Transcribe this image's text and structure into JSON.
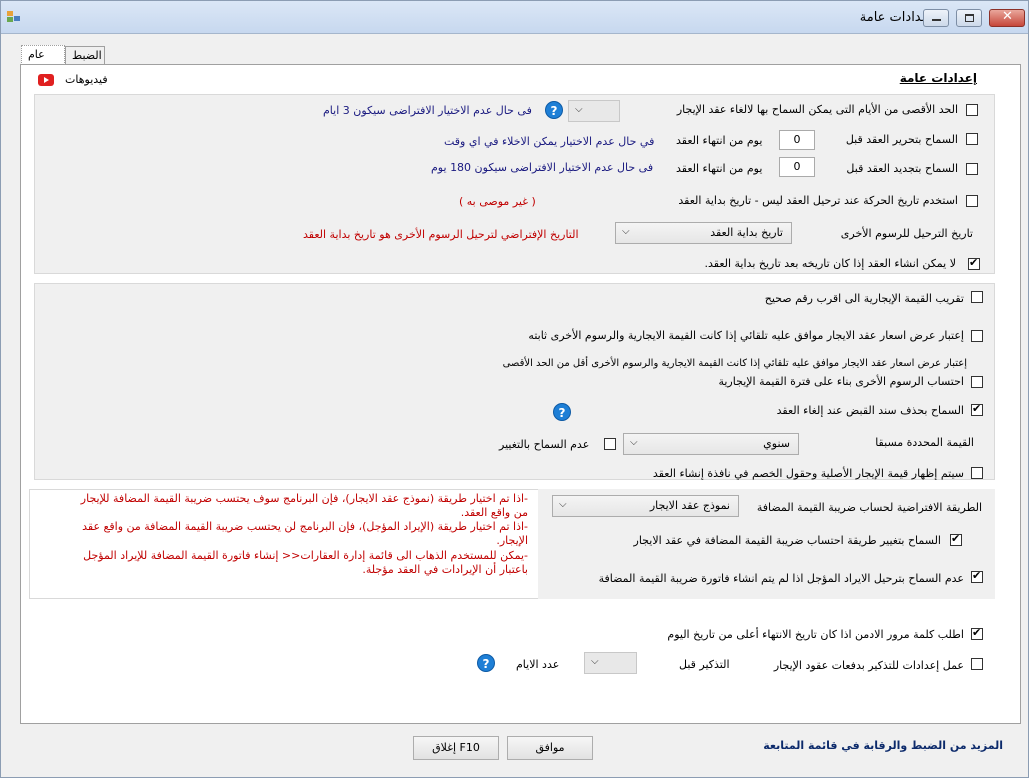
{
  "window": {
    "title": "إعدادات عامة"
  },
  "tabs": [
    {
      "label": "عام"
    },
    {
      "label": "الضبط"
    }
  ],
  "header": {
    "title": "إعدادات عامة",
    "videos_label": "فيديوهات"
  },
  "section1": {
    "max_days_label": "الحد الأقصى من الأيام التى يمكن السماح بها لالغاء عقد الإيجار",
    "max_days_note": "فى حال عدم الاختيار الافتراضى سيكون 3 ايام",
    "edit_before_label": "السماح بتحرير العقد قبل",
    "edit_before_value": "0",
    "edit_before_unit": "يوم من انتهاء العقد",
    "edit_before_note": "في حال عدم الاختيار يمكن الاخلاء في اي وقت",
    "renew_before_label": "السماح بتجديد العقد قبل",
    "renew_before_value": "0",
    "renew_before_unit": "يوم من انتهاء العقد",
    "renew_before_note": "فى حال عدم الاختيار الافتراضى سيكون 180 يوم",
    "use_movement_date_label": "استخدم تاريخ الحركة عند ترحيل العقد ليس - تاريخ بداية العقد",
    "not_recommended": "( غير موصى به )",
    "posting_date_label": "تاريخ الترحيل للرسوم الأخرى",
    "posting_date_value": "تاريخ بداية العقد",
    "posting_date_note": "التاريخ الإفتراضي لترحيل الرسوم الأخرى هو تاريخ بداية العقد",
    "no_create_after_start_label": "لا يمكن انشاء العقد إذا كان تاريخه بعد تاريخ بداية العقد."
  },
  "section2": {
    "round_label": "تقريب القيمة الإيجارية الى اقرب رقم صحيح",
    "consider_offer_fixed_label": "إعتبار عرض اسعار عقد الايجار موافق عليه تلقائي   إذا كانت القيمة الايجارية والرسوم الأخرى ثابته",
    "consider_offer_less_label": "إعتبار عرض اسعار عقد الايجار موافق عليه تلقائي   إذا كانت القيمة الايجارية والرسوم الأخرى أقل من الحد الأقصى",
    "calc_fees_label": "احتساب الرسوم الأخرى بناء على فترة القيمة الإيجارية",
    "allow_delete_receipt_label": "السماح بحذف سند القبض عند إلغاء العقد",
    "predefined_value_label": "القيمة المحددة مسبقا",
    "predefined_value_select": "سنوي",
    "no_change_label": "عدم السماح بالتغيير",
    "show_original_value_label": "سيتم إظهار قيمة الإيجار الأصلية وحقول الخصم في نافذة إنشاء العقد"
  },
  "section3": {
    "default_method_label": "الطريقة   الافتراضية لحساب ضريبة القيمة المضافة",
    "default_method_value": "نموذج عقد الايجار",
    "allow_change_method_label": "السماح بتغيير طريقة احتساب ضريبة القيمة المضافة في عقد الايجار",
    "no_deferred_revenue_label": "عدم السماح بترحيل الايراد المؤجل اذا لم يتم انشاء فاتورة ضريبة القيمة المضافة",
    "notes": [
      "-اذا تم اختيار طريقة (نموذج عقد الايجار)، فإن البرنامج سوف يحتسب ضريبة القيمة المضافة للإيجار",
      "من   واقع العقد.",
      "-اذا تم اختيار طريقة (الإيراد المؤجل)، فإن البرنامج لن يحتسب ضريبة القيمة المضافة من واقع عقد",
      "الإيجار.",
      "-يمكن للمستخدم الذهاب الى قائمة إدارة العقارات<<   إنشاء فاتورة القيمة المضافة للإيراد المؤجل",
      "باعتبار  أن الإيرادات في العقد مؤجلة."
    ]
  },
  "section4": {
    "require_admin_password_label": "اطلب كلمة مرور الادمن اذا كان تاريخ الانتهاء أعلى من تاريخ اليوم",
    "reminder_settings_label": "عمل إعدادات للتذكير بدفعات عقود الإيجار",
    "reminder_before_label": "التذكير قبل",
    "days_count_label": "عدد الايام"
  },
  "footer": {
    "more_link": "المزيد من الضبط والرقابة في قائمة المتابعة",
    "ok_label": "موافق",
    "close_label": "إغلاق F10"
  },
  "colors": {
    "accent_red": "#c00000",
    "link_blue": "#0c2a6b",
    "help_blue": "#1e7fd6"
  }
}
